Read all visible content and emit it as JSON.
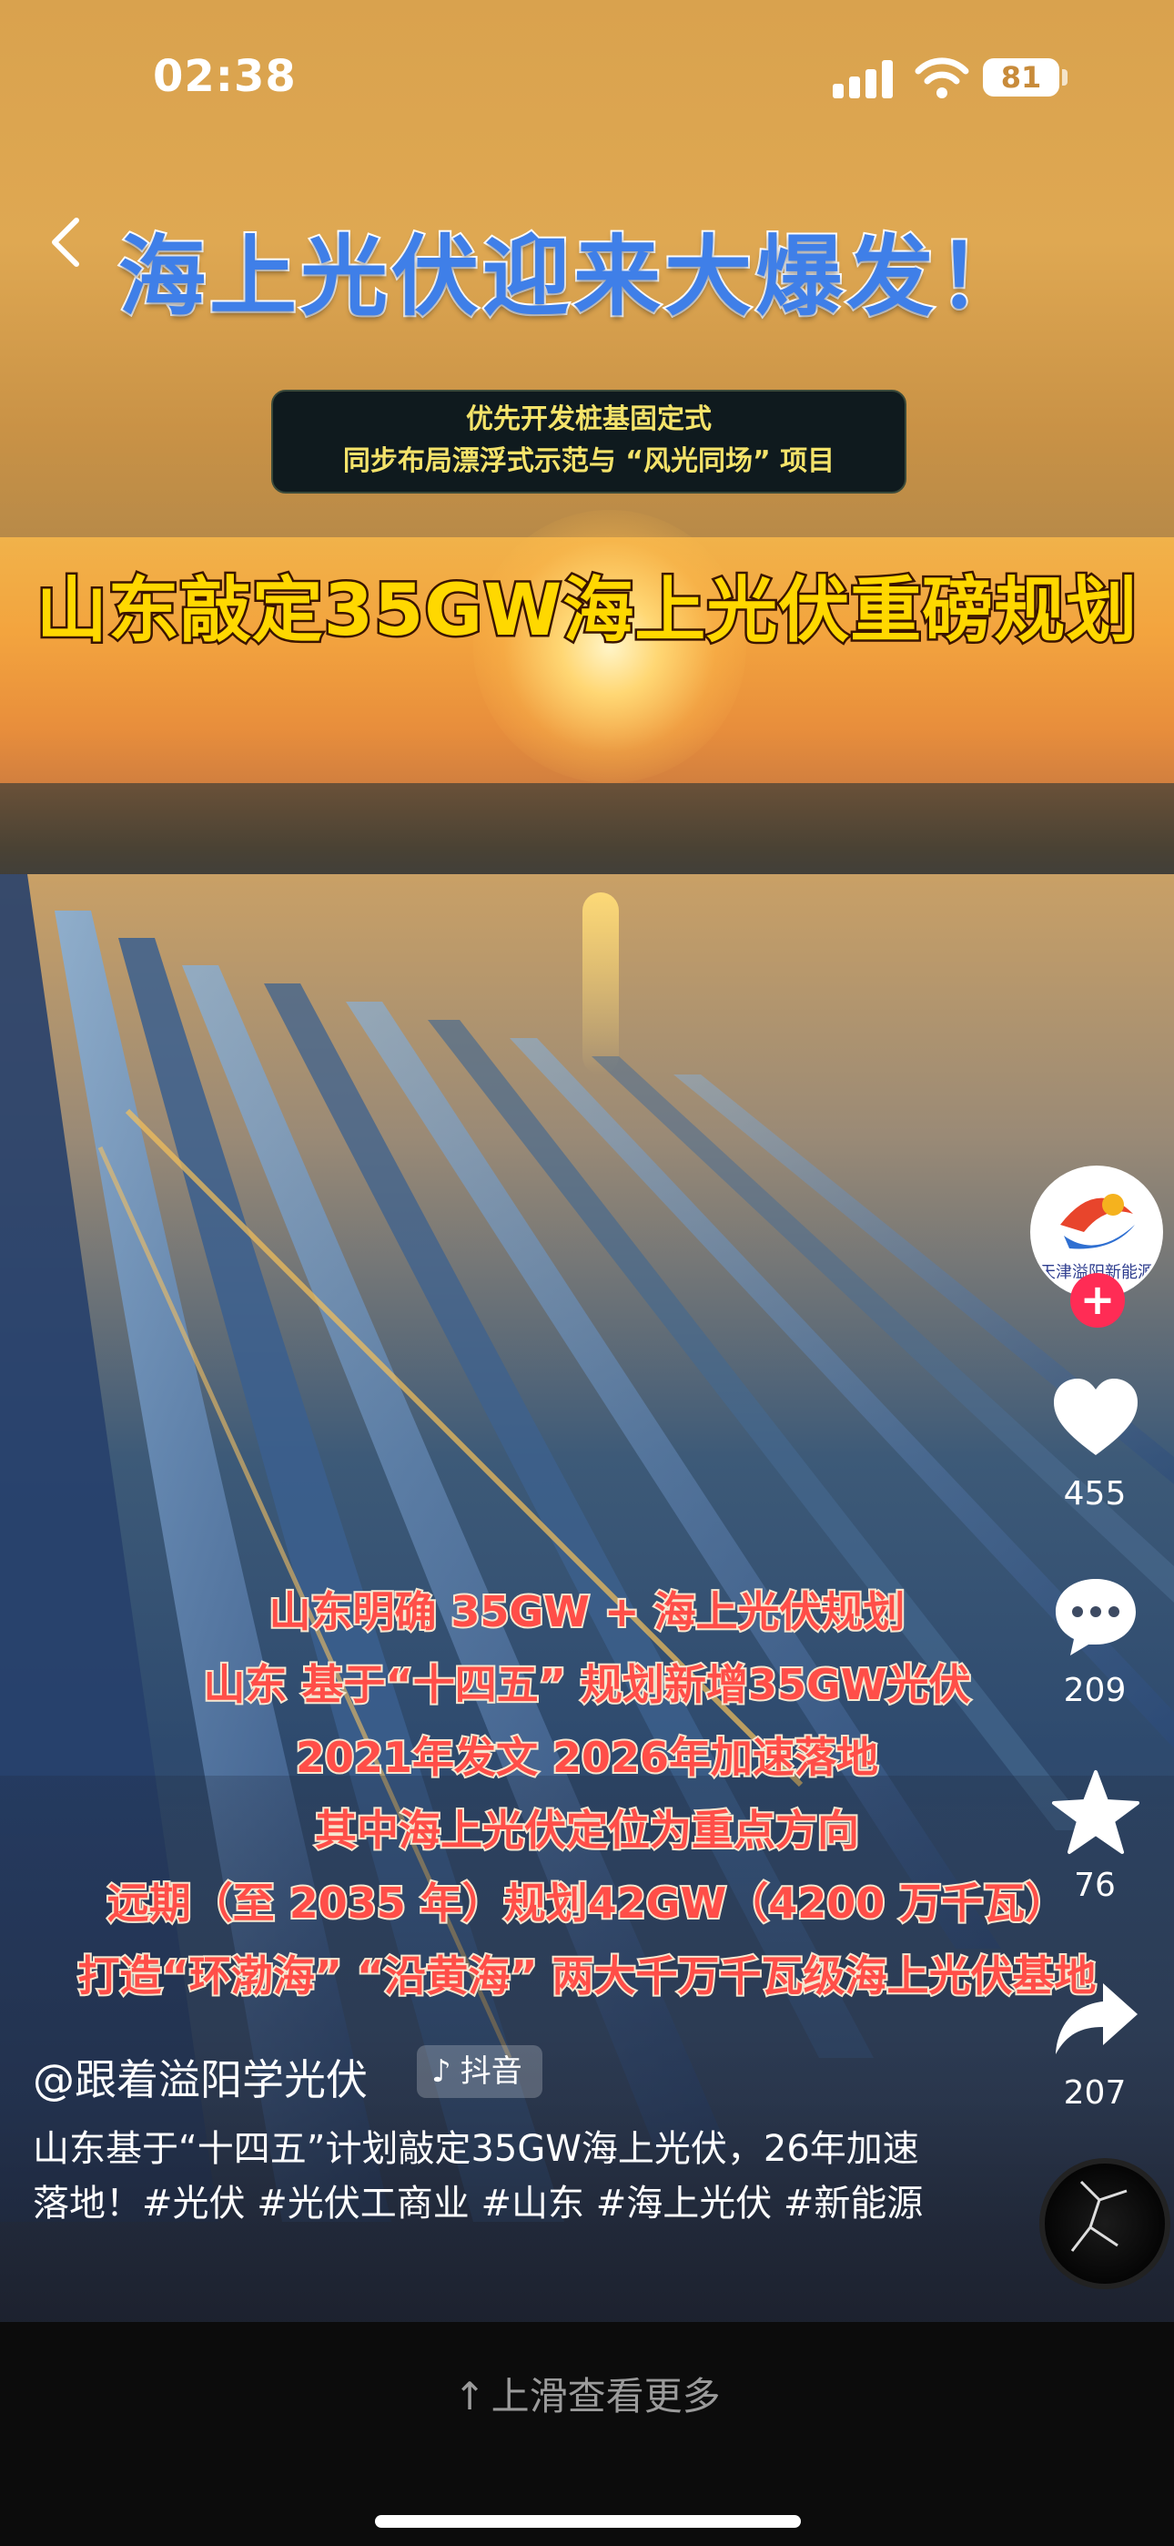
{
  "status_bar": {
    "time": "02:38",
    "battery": "81"
  },
  "video": {
    "headline": "海上光伏迎来大爆发！",
    "subtitle_lines": [
      "优先开发桩基固定式",
      "同步布局漂浮式示范与 “风光同场” 项目"
    ],
    "banner": "山东敲定35GW海上光伏重磅规划",
    "captions": [
      "山东明确 35GW + 海上光伏规划",
      "山东 基于“十四五” 规划新增35GW光伏",
      "2021年发文 2026年加速落地",
      "其中海上光伏定位为重点方向",
      "远期（至 2035 年）规划42GW（4200 万千瓦）",
      "打造“环渤海” “沿黄海” 两大千万千瓦级海上光伏基地"
    ]
  },
  "rail": {
    "avatar_text": "天津溢阳新能源",
    "likes": "455",
    "comments": "209",
    "favorites": "76",
    "shares": "207"
  },
  "post": {
    "author": "@跟着溢阳学光伏",
    "platform": "抖音",
    "description": "山东基于“十四五”计划敲定35GW海上光伏，26年加速落地！#光伏 #光伏工商业 #山东 #海上光伏 #新能源"
  },
  "bottom": {
    "swipe_hint": "上滑查看更多"
  }
}
